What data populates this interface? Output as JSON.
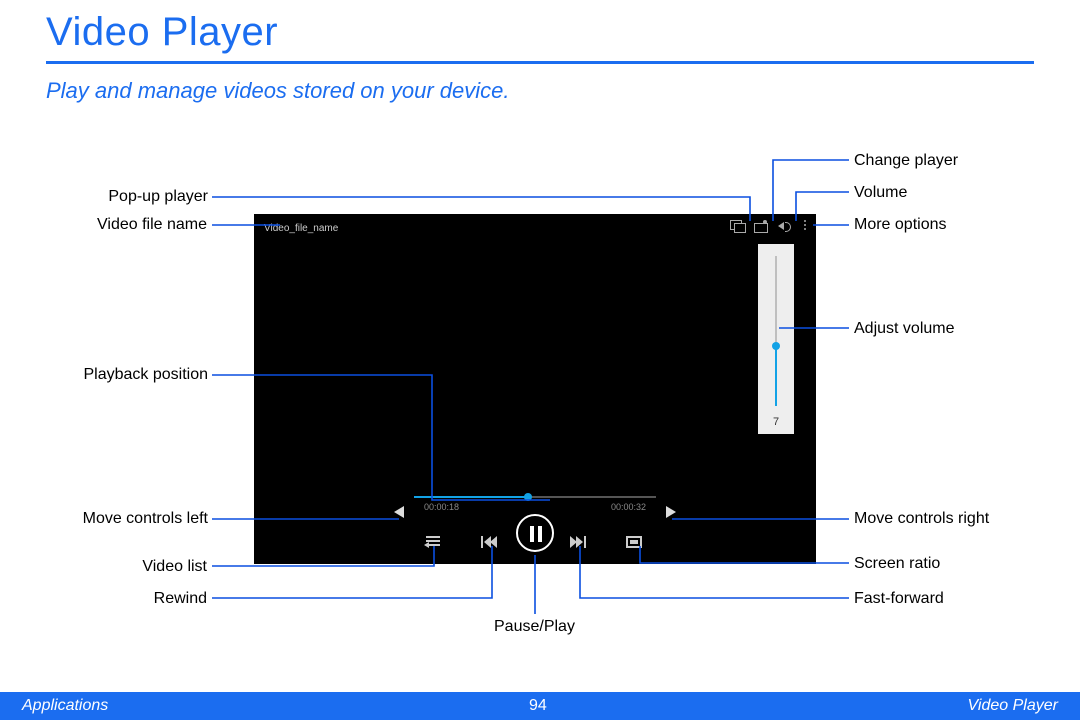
{
  "heading": "Video Player",
  "subtitle": "Play and manage videos stored on your device.",
  "player": {
    "filename": "Video_file_name",
    "volume_value": "7",
    "time_elapsed": "00:00:18",
    "time_total": "00:00:32"
  },
  "labels": {
    "popup_player": "Pop-up player",
    "video_file_name": "Video file name",
    "playback_position": "Playback position",
    "move_controls_left": "Move controls left",
    "video_list": "Video list",
    "rewind": "Rewind",
    "pause_play": "Pause/Play",
    "change_player": "Change player",
    "volume": "Volume",
    "more_options": "More options",
    "adjust_volume": "Adjust volume",
    "move_controls_right": "Move controls right",
    "screen_ratio": "Screen ratio",
    "fast_forward": "Fast-forward"
  },
  "footer": {
    "left": "Applications",
    "page": "94",
    "right": "Video Player"
  }
}
